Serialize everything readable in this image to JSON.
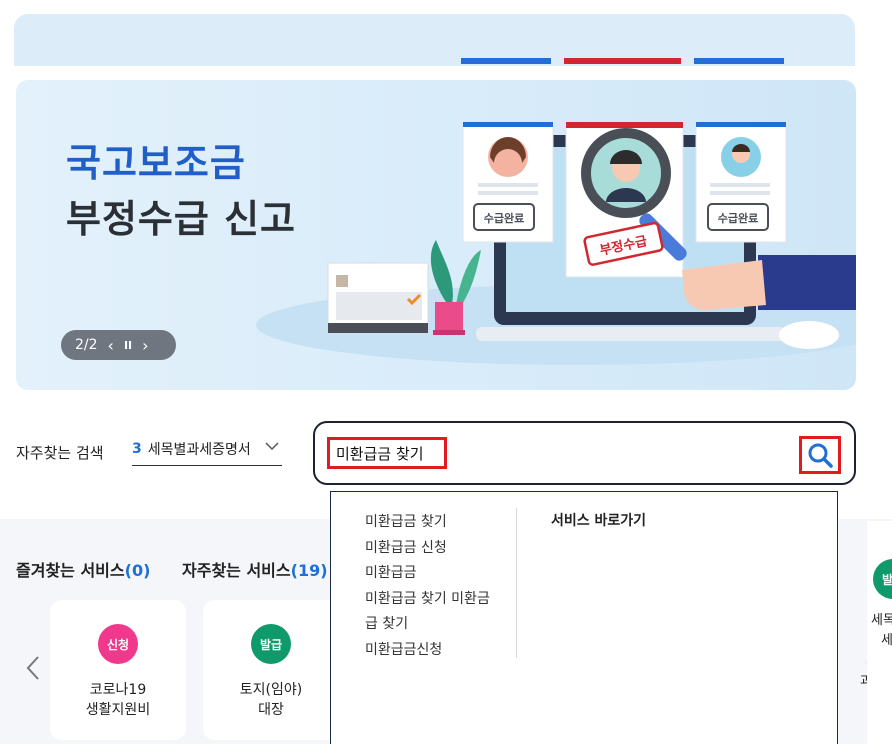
{
  "banner": {
    "title_line1": "국고보조금",
    "title_line2": "부정수급 신고",
    "slide_counter": "2/2",
    "stamp_completed": "수급완료",
    "stamp_fraud": "부정수급",
    "accent_color": "#1f5fc7"
  },
  "search": {
    "label": "자주찾는 검색",
    "keyword_rank": "3",
    "keyword_text": "세목별과세증명서",
    "input_value": "미환급금 찾기",
    "highlight_color": "#e21b23"
  },
  "autocomplete": {
    "items": [
      "미환급금 찾기",
      "미환급금 신청",
      "미환급금",
      "미환급금 찾기 미환금",
      "급 찾기",
      "미환급금신청"
    ],
    "service_header": "서비스 바로가기"
  },
  "tabs": {
    "favorites_label": "즐겨찾는 서비스",
    "favorites_count": "(0)",
    "frequent_label": "자주찾는 서비스",
    "frequent_count": "(19)"
  },
  "cards": [
    {
      "badge": "신청",
      "badge_color": "#f0388d",
      "line1": "코로나19",
      "line2": "생활지원비"
    },
    {
      "badge": "발급",
      "badge_color": "#109a6c",
      "line1": "토지(임야)",
      "line2": "대장"
    }
  ],
  "right_partial": {
    "badge": "발급",
    "line1": "세목",
    "line2": "세",
    "mid_line1": "서",
    "mid_line2": "과서"
  }
}
